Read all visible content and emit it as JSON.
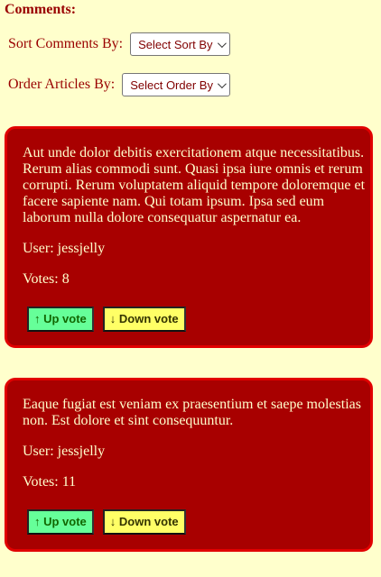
{
  "heading": "Comments:",
  "controls": {
    "sort_label": "Sort Comments By:",
    "sort_value": "Select Sort By",
    "order_label": "Order Articles By:",
    "order_value": "Select Order By"
  },
  "comments": [
    {
      "body": "Aut unde dolor debitis exercitationem atque necessitatibus. Rerum alias commodi sunt. Quasi ipsa iure omnis et rerum corrupti. Rerum voluptatem aliquid tempore doloremque et facere sapiente nam. Qui totam ipsum. Ipsa sed eum laborum nulla dolore consequatur aspernatur ea.",
      "user": "User: jessjelly",
      "votes": "Votes: 8",
      "up_label": "↑ Up vote",
      "down_label": "↓ Down vote"
    },
    {
      "body": "Eaque fugiat est veniam ex praesentium et saepe molestias non. Est dolore et sint consequuntur.",
      "user": "User: jessjelly",
      "votes": "Votes: 11",
      "up_label": "↑ Up vote",
      "down_label": "↓ Down vote"
    }
  ],
  "colors": {
    "page_bg": "#ffffcc",
    "card_bg": "#a80000",
    "card_border": "#e10000",
    "up_button": "#66ff99",
    "down_button": "#ffff66"
  }
}
